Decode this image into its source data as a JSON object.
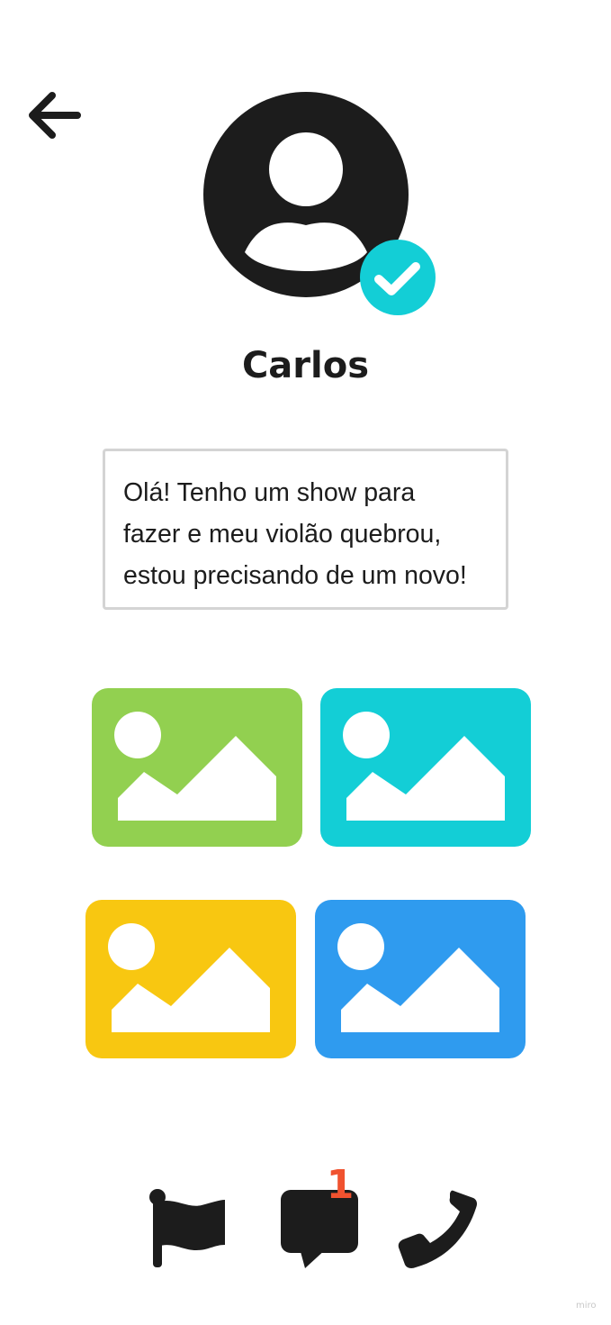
{
  "profile": {
    "name": "Carlos",
    "verified": true
  },
  "message": {
    "text": "Olá! Tenho um show para\nfazer e meu violão quebrou,\nestou precisando de um novo!"
  },
  "photos": [
    {
      "icon": "image-icon",
      "color": "#92d050"
    },
    {
      "icon": "image-icon",
      "color": "#13ced6"
    },
    {
      "icon": "image-icon",
      "color": "#f8c711"
    },
    {
      "icon": "image-icon",
      "color": "#2f9bef"
    }
  ],
  "actions": {
    "flag_icon": "flag-icon",
    "chat_icon": "chat-icon",
    "chat_badge": "1",
    "phone_icon": "phone-icon"
  },
  "colors": {
    "dark": "#1c1c1c",
    "accent": "#13ced6",
    "badge": "#f0522f"
  },
  "watermark": "miro"
}
